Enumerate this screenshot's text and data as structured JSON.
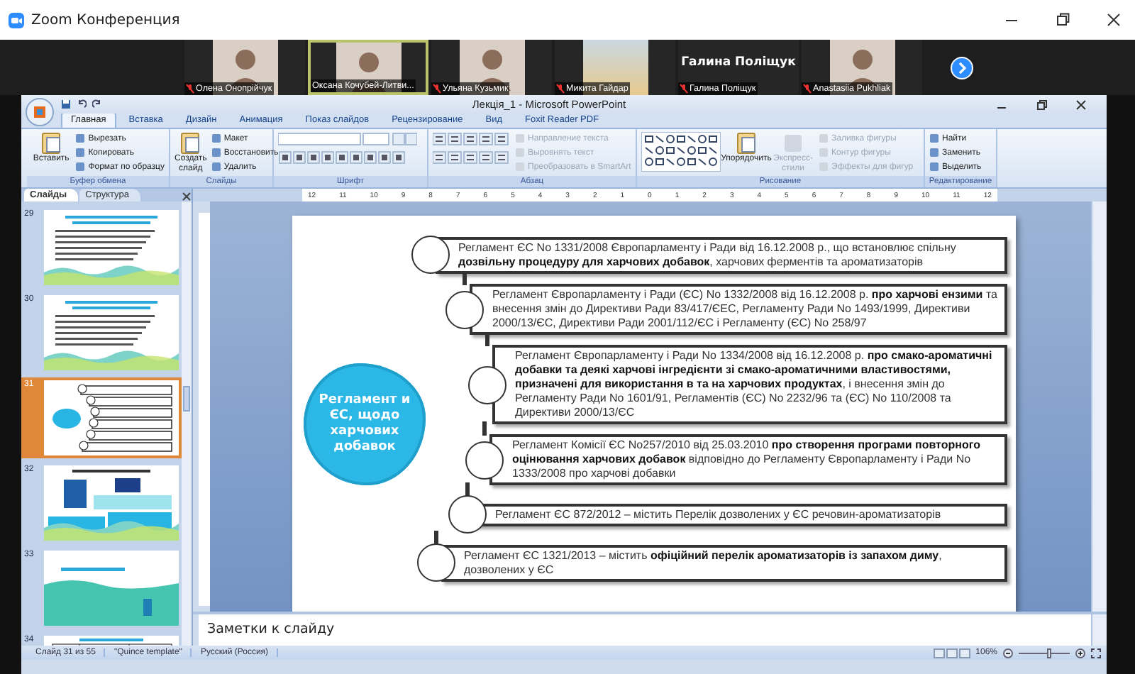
{
  "app": {
    "title": "Zoom Конференция"
  },
  "participants": [
    {
      "name": "Олена Онопрійчук",
      "kind": "video",
      "muted": true,
      "selected": false
    },
    {
      "name": "Оксана Кочубей-Литви...",
      "kind": "video",
      "muted": false,
      "selected": true
    },
    {
      "name": "Ульяна Кузьмик",
      "kind": "video",
      "muted": true,
      "selected": false
    },
    {
      "name": "Микита Гайдар",
      "kind": "picture",
      "muted": true,
      "selected": false
    },
    {
      "name": "Галина Поліщук",
      "kind": "name",
      "display_name": "Галина Поліщук",
      "muted": true,
      "selected": false
    },
    {
      "name": "Anastasiia Pukhliak",
      "kind": "video",
      "muted": true,
      "selected": false
    }
  ],
  "powerpoint": {
    "title": "Лекція_1 - Microsoft PowerPoint",
    "tabs": [
      {
        "label": "Главная",
        "selected": true
      },
      {
        "label": "Вставка",
        "selected": false
      },
      {
        "label": "Дизайн",
        "selected": false
      },
      {
        "label": "Анимация",
        "selected": false
      },
      {
        "label": "Показ слайдов",
        "selected": false
      },
      {
        "label": "Рецензирование",
        "selected": false
      },
      {
        "label": "Вид",
        "selected": false
      },
      {
        "label": "Foxit Reader PDF",
        "selected": false
      }
    ],
    "ribbon": [
      {
        "label": "Буфер обмена",
        "items": [
          {
            "kind": "large",
            "label": "Вставить",
            "disabled": false
          },
          {
            "kind": "small",
            "label": "Вырезать",
            "disabled": false
          },
          {
            "kind": "small",
            "label": "Копировать",
            "disabled": false
          },
          {
            "kind": "small",
            "label": "Формат по образцу",
            "disabled": false
          }
        ]
      },
      {
        "label": "Слайды",
        "items": [
          {
            "kind": "large",
            "label": "Создать слайд",
            "disabled": false
          },
          {
            "kind": "small",
            "label": "Макет",
            "disabled": false
          },
          {
            "kind": "small",
            "label": "Восстановить",
            "disabled": false
          },
          {
            "kind": "small",
            "label": "Удалить",
            "disabled": false
          }
        ]
      },
      {
        "label": "Шрифт",
        "items": [
          {
            "kind": "font"
          }
        ]
      },
      {
        "label": "Абзац",
        "items": [
          {
            "kind": "paragraph"
          },
          {
            "kind": "small",
            "label": "Направление текста",
            "disabled": true
          },
          {
            "kind": "small",
            "label": "Выровнять текст",
            "disabled": true
          },
          {
            "kind": "small",
            "label": "Преобразовать в SmartArt",
            "disabled": true
          }
        ]
      },
      {
        "label": "Рисование",
        "items": [
          {
            "kind": "shapes"
          },
          {
            "kind": "large",
            "label": "Упорядочить",
            "disabled": false
          },
          {
            "kind": "large",
            "label": "Экспресс-стили",
            "disabled": true
          },
          {
            "kind": "small",
            "label": "Заливка фигуры",
            "disabled": true
          },
          {
            "kind": "small",
            "label": "Контур фигуры",
            "disabled": true
          },
          {
            "kind": "small",
            "label": "Эффекты для фигур",
            "disabled": true
          }
        ]
      },
      {
        "label": "Редактирование",
        "items": [
          {
            "kind": "small",
            "label": "Найти",
            "disabled": false
          },
          {
            "kind": "small",
            "label": "Заменить",
            "disabled": false
          },
          {
            "kind": "small",
            "label": "Выделить",
            "disabled": false
          }
        ]
      }
    ],
    "pane_tabs": [
      {
        "label": "Слайды",
        "selected": true
      },
      {
        "label": "Структура",
        "selected": false
      }
    ],
    "thumbnails": [
      {
        "number": "29",
        "kind": "text",
        "selected": false
      },
      {
        "number": "30",
        "kind": "text",
        "selected": false
      },
      {
        "number": "31",
        "kind": "diagram",
        "selected": true
      },
      {
        "number": "32",
        "kind": "images",
        "selected": false
      },
      {
        "number": "33",
        "kind": "title",
        "selected": false
      },
      {
        "number": "34",
        "kind": "table",
        "selected": false
      }
    ],
    "ruler": [
      "12",
      "11",
      "10",
      "9",
      "8",
      "7",
      "6",
      "5",
      "4",
      "3",
      "2",
      "1",
      "0",
      "1",
      "2",
      "3",
      "4",
      "5",
      "6",
      "7",
      "8",
      "9",
      "10",
      "11",
      "12"
    ],
    "notes": {
      "placeholder": "Заметки к слайду"
    },
    "status": [
      "Слайд 31 из 55",
      "\"Quince template\"",
      "Русский (Россия)"
    ],
    "zoom": "106%",
    "zoom_slider": {
      "level": 0.6
    }
  },
  "slide": {
    "cloud": "Регламент и ЄС, щодо харчових добавок",
    "entries": [
      "Регламент ЄС No 1331/2008 Європарламенту і Ради від 16.12.2008 р., що встановлює спільну **дозвільну процедуру для харчових добавок**, харчових ферментів та ароматизаторів",
      "Регламент Європарламенту і Ради (ЄС) No 1332/2008 від 16.12.2008 р. **про харчові ензими** та внесення змін до Директиви Ради 83/417/ЄЕС, Регламенту Ради No 1493/1999, Директиви 2000/13/ЄС, Директиви Ради 2001/112/ЄС і Регламенту (ЄС) No 258/97",
      "Регламент Європарламенту і Ради No 1334/2008 від 16.12.2008 р. **про смако-ароматичні добавки та деякі харчові інгредієнти зі смако-ароматичними властивостями, призначені для використання в та на харчових продуктах**, і внесення змін до Регламенту Ради No 1601/91, Регламентів (ЄС) No 2232/96 та (ЄС) No 110/2008 та Директиви 2000/13/ЄС",
      "Регламент Комісії ЄС No257/2010 від 25.03.2010 **про створення програми повторного оцінювання харчових добавок** відповідно до Регламенту Європарламенту і Ради No 1333/2008 про харчові добавки",
      "Регламент ЄС  872/2012 – містить Перелік дозволених у ЄС речовин-ароматизаторів",
      "Регламент ЄС 1321/2013 – містить **офіційний перелік ароматизаторів із запахом диму**, дозволених у ЄС"
    ]
  }
}
